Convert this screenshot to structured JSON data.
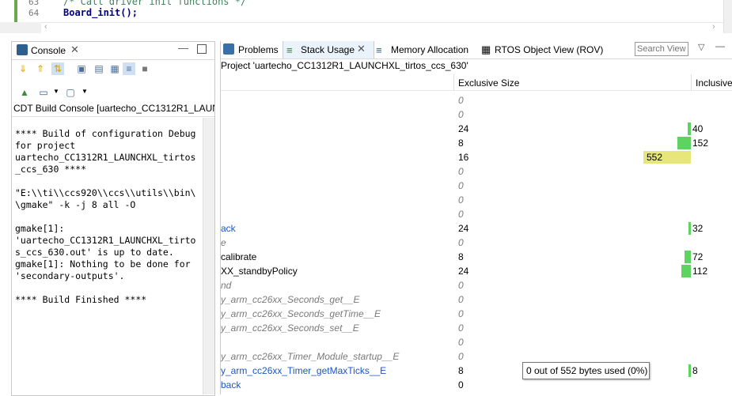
{
  "editor": {
    "lines": [
      {
        "num": "63",
        "code": "/* Call driver init functions */"
      },
      {
        "num": "64",
        "code": "Board_init();"
      }
    ]
  },
  "console": {
    "tab_label": "Console",
    "header": "CDT Build Console [uartecho_CC1312R1_LAUNC",
    "output": "**** Build of configuration Debug\nfor project\nuartecho_CC1312R1_LAUNCHXL_tirtos\n_ccs_630 ****\n\n\"E:\\\\ti\\\\ccs920\\\\ccs\\\\utils\\\\bin\\\n\\gmake\" -k -j 8 all -O\n\ngmake[1]:\n'uartecho_CC1312R1_LAUNCHXL_tirto\ns_ccs_630.out' is up to date.\ngmake[1]: Nothing to be done for\n'secondary-outputs'.\n\n**** Build Finished ****"
  },
  "right_tabs": {
    "problems": "Problems",
    "stack_usage": "Stack Usage",
    "memory_allocation": "Memory Allocation",
    "rtos_view": "RTOS Object View (ROV)",
    "search_placeholder": "Search View"
  },
  "project_title": "Project 'uartecho_CC1312R1_LAUNCHXL_tirtos_ccs_630'",
  "columns": {
    "exclusive": "Exclusive Size",
    "inclusive": "Inclusive"
  },
  "rows": [
    {
      "name": "",
      "excl": "0",
      "incl": "",
      "style": "italic"
    },
    {
      "name": "",
      "excl": "0",
      "incl": "",
      "style": "italic"
    },
    {
      "name": "",
      "excl": "24",
      "incl": "40",
      "style": "normal",
      "bar": 0.072
    },
    {
      "name": "",
      "excl": "8",
      "incl": "152",
      "style": "normal",
      "bar": 0.275
    },
    {
      "name": "",
      "excl": "16",
      "incl": "552",
      "style": "normal",
      "bar": 1.0
    },
    {
      "name": "",
      "excl": "0",
      "incl": "",
      "style": "italic"
    },
    {
      "name": "",
      "excl": "0",
      "incl": "",
      "style": "italic"
    },
    {
      "name": "",
      "excl": "0",
      "incl": "",
      "style": "italic"
    },
    {
      "name": "",
      "excl": "0",
      "incl": "",
      "style": "italic"
    },
    {
      "name": "ack",
      "excl": "24",
      "incl": "32",
      "style": "link",
      "bar": 0.058
    },
    {
      "name": "e",
      "excl": "0",
      "incl": "",
      "style": "italic"
    },
    {
      "name": "calibrate",
      "excl": "8",
      "incl": "72",
      "style": "normal",
      "bar": 0.13
    },
    {
      "name": "XX_standbyPolicy",
      "excl": "24",
      "incl": "112",
      "style": "normal",
      "bar": 0.203
    },
    {
      "name": "nd",
      "excl": "0",
      "incl": "",
      "style": "italic"
    },
    {
      "name": "y_arm_cc26xx_Seconds_get__E",
      "excl": "0",
      "incl": "",
      "style": "italic"
    },
    {
      "name": "y_arm_cc26xx_Seconds_getTime__E",
      "excl": "0",
      "incl": "",
      "style": "italic"
    },
    {
      "name": "y_arm_cc26xx_Seconds_set__E",
      "excl": "0",
      "incl": "",
      "style": "italic"
    },
    {
      "name": "",
      "excl": "0",
      "incl": "",
      "style": "italic"
    },
    {
      "name": "y_arm_cc26xx_Timer_Module_startup__E",
      "excl": "0",
      "incl": "",
      "style": "italic"
    },
    {
      "name": "y_arm_cc26xx_Timer_getMaxTicks__E",
      "excl": "8",
      "incl": "8",
      "style": "link",
      "bar": 0.015
    },
    {
      "name": "back",
      "excl": "0",
      "incl": "",
      "style": "link"
    }
  ],
  "tooltip": "0 out of 552 bytes used (0%)",
  "colors": {
    "bar_green": "#5fd35f",
    "bar_yellow": "#e6e67a",
    "link": "#1a56c5"
  }
}
